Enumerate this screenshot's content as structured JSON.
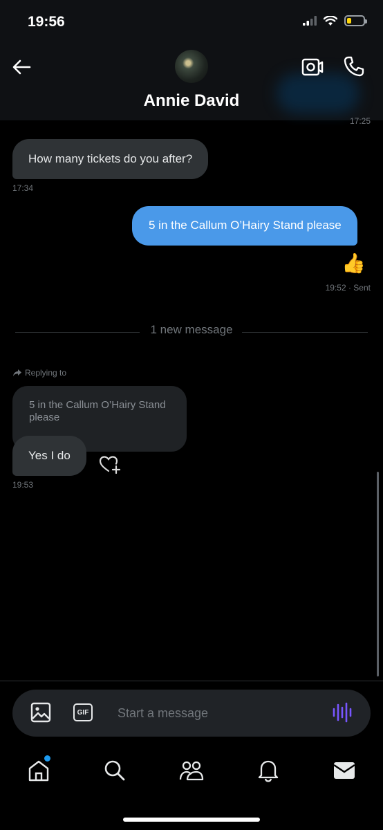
{
  "status_bar": {
    "time": "19:56",
    "battery_level": 0.25,
    "battery_color": "#ffd60a"
  },
  "header": {
    "contact_name": "Annie David",
    "prior_timestamp": "17:25"
  },
  "messages": [
    {
      "direction": "incoming",
      "text": "How many tickets do you after?",
      "time": "17:34"
    },
    {
      "direction": "outgoing",
      "text": "5 in the Callum O’Hairy Stand please"
    },
    {
      "direction": "outgoing",
      "text": "👍",
      "time": "19:52 · Sent"
    }
  ],
  "divider": {
    "label": "1 new message"
  },
  "reply": {
    "replying_label": "Replying to",
    "quoted_text": "5 in the Callum O’Hairy Stand please",
    "text": "Yes I do",
    "time": "19:53"
  },
  "composer": {
    "placeholder": "Start a message",
    "gif_label": "GIF"
  },
  "nav": {
    "items": [
      "home-icon",
      "search-icon",
      "communities-icon",
      "bell-icon",
      "mail-icon"
    ],
    "home_has_notification": true
  },
  "colors": {
    "accent": "#1d9bf0",
    "outgoing_bubble": "#4a99e9",
    "incoming_bubble": "#2f3336",
    "voice_accent": "#7856ff"
  }
}
